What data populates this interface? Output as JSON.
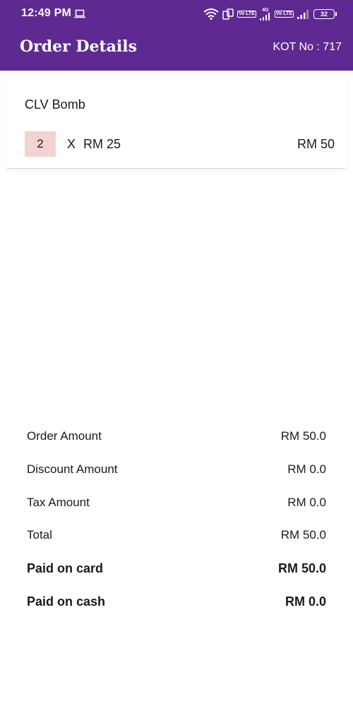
{
  "status_bar": {
    "time": "12:49 PM",
    "battery": "32",
    "network_badge_1": "Vo LTE",
    "network_type": "4G",
    "network_badge_2": "Vo LTE"
  },
  "app_bar": {
    "title": "Order Details",
    "kot": "KOT No : 717"
  },
  "items": [
    {
      "name": "CLV Bomb",
      "quantity": "2",
      "times": "X",
      "unit_price": "RM 25",
      "total": "RM 50"
    }
  ],
  "summary": {
    "order_amount_label": "Order Amount",
    "order_amount_value": "RM 50.0",
    "discount_amount_label": "Discount Amount",
    "discount_amount_value": "RM 0.0",
    "tax_amount_label": "Tax Amount",
    "tax_amount_value": "RM 0.0",
    "total_label": "Total",
    "total_value": "RM 50.0",
    "paid_on_card_label": "Paid on card",
    "paid_on_card_value": "RM 50.0",
    "paid_on_cash_label": "Paid on cash",
    "paid_on_cash_value": "RM 0.0"
  },
  "colors": {
    "header": "#5e2a91",
    "qty_background": "#f3d2d2"
  },
  "icons": [
    "laptop-icon",
    "wifi-icon",
    "screen-rotate-icon",
    "signal-icon",
    "battery-icon"
  ]
}
